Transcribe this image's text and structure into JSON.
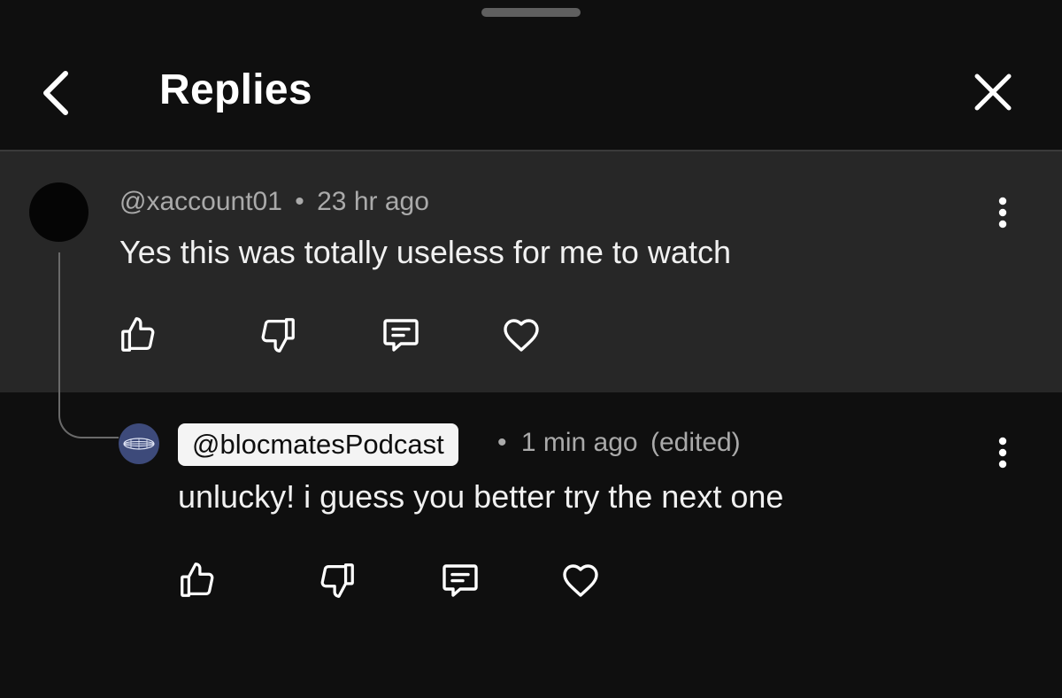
{
  "header": {
    "title": "Replies"
  },
  "parent_comment": {
    "author": "@xaccount01",
    "separator": "•",
    "time": "23 hr ago",
    "text": "Yes this was totally useless for me to watch"
  },
  "reply": {
    "author": "@blocmatesPodcast",
    "separator": "•",
    "time": "1 min ago",
    "edited": "(edited)",
    "text": "unlucky! i guess you better try the next one"
  },
  "icons": {
    "back": "chevron-left-icon",
    "close": "close-icon",
    "more": "more-vertical-icon",
    "like": "thumbs-up-icon",
    "dislike": "thumbs-down-icon",
    "reply": "comment-icon",
    "heart": "heart-icon"
  },
  "colors": {
    "background": "#0f0f0f",
    "highlight_background": "#272727",
    "text_primary": "#f1f1f1",
    "text_secondary": "#aaaaaa",
    "chip_background": "#f4f4f4"
  }
}
